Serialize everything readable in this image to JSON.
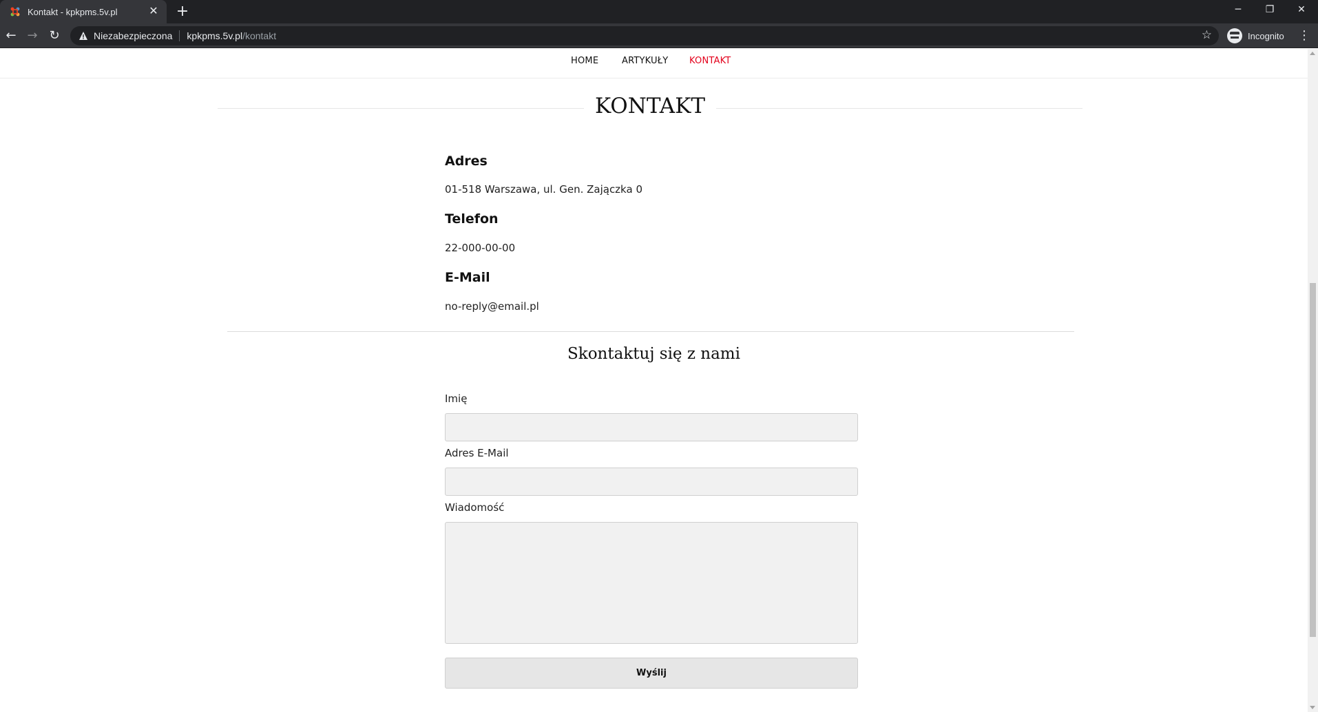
{
  "browser": {
    "tab_title": "Kontakt - kpkpms.5v.pl",
    "new_tab_icon": "+",
    "close_tab_icon": "✕",
    "security_label": "Niezabezpieczona",
    "url_host": "kpkpms.5v.pl",
    "url_path": "/kontakt",
    "incognito_label": "Incognito",
    "window_controls": {
      "minimize": "─",
      "restore": "❐",
      "close": "✕"
    }
  },
  "nav": {
    "items": [
      {
        "label": "HOME",
        "active": false
      },
      {
        "label": "ARTYKUŁY",
        "active": false
      },
      {
        "label": "KONTAKT",
        "active": true
      }
    ],
    "active_color": "#e3001b"
  },
  "page": {
    "title": "KONTAKT",
    "contact": {
      "address_heading": "Adres",
      "address_value": "01-518 Warszawa, ul. Gen. Zajączka 0",
      "phone_heading": "Telefon",
      "phone_value": "22-000-00-00",
      "email_heading": "E-Mail",
      "email_value": "no-reply@email.pl"
    },
    "form": {
      "title": "Skontaktuj się z nami",
      "name_label": "Imię",
      "name_value": "",
      "email_label": "Adres E-Mail",
      "email_value": "",
      "message_label": "Wiadomość",
      "message_value": "",
      "submit_label": "Wyślij"
    }
  }
}
